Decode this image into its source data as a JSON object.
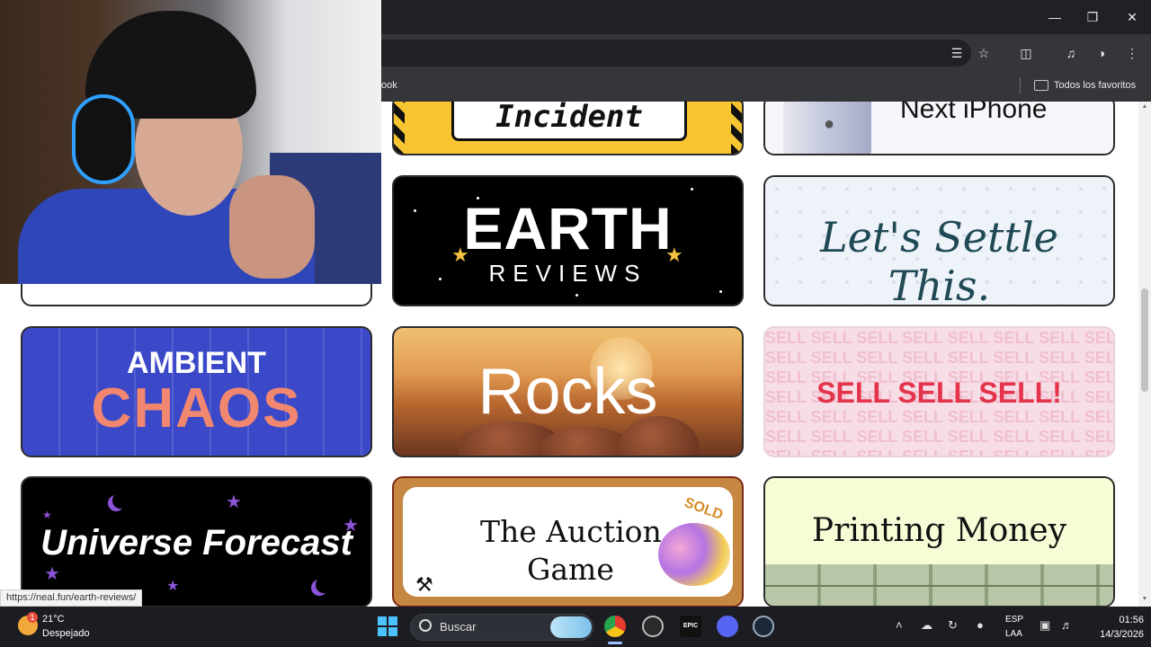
{
  "browser": {
    "bookmark_partial": "ook",
    "bookmark_folder": "Todos los favoritos"
  },
  "cards": {
    "incident": "Incident",
    "next_iphone": "Next iPhone",
    "earth_title": "EARTH",
    "earth_sub": "REVIEWS",
    "settle": "Let's Settle This.",
    "ambient_1": "AMBIENT",
    "ambient_2": "CHAOS",
    "rocks": "Rocks",
    "sell": "SELL SELL SELL!",
    "sell_bg": "SELL",
    "universe": "Universe Forecast",
    "auction_1": "The Auction",
    "auction_2": "Game",
    "auction_sold": "SOLD",
    "printing": "Printing Money"
  },
  "status_url": "https://neal.fun/earth-reviews/",
  "taskbar": {
    "weather_temp": "21°C",
    "weather_condition": "Despejado",
    "weather_badge": "1",
    "search_label": "Buscar",
    "lang_1": "ESP",
    "lang_2": "LAA",
    "time": "01:56",
    "date": "14/3/2026"
  },
  "icons": [
    "minimize-icon",
    "maximize-icon",
    "close-icon",
    "translate-icon",
    "star-icon",
    "extensions-icon",
    "media-icon",
    "profile-icon",
    "menu-icon",
    "folder-icon",
    "windows-start-icon",
    "search-icon",
    "chrome-icon",
    "obs-icon",
    "epic-games-icon",
    "discord-icon",
    "steam-icon",
    "chevron-up-icon",
    "cloud-icon",
    "sync-icon",
    "microphone-icon",
    "network-icon",
    "volume-icon"
  ]
}
